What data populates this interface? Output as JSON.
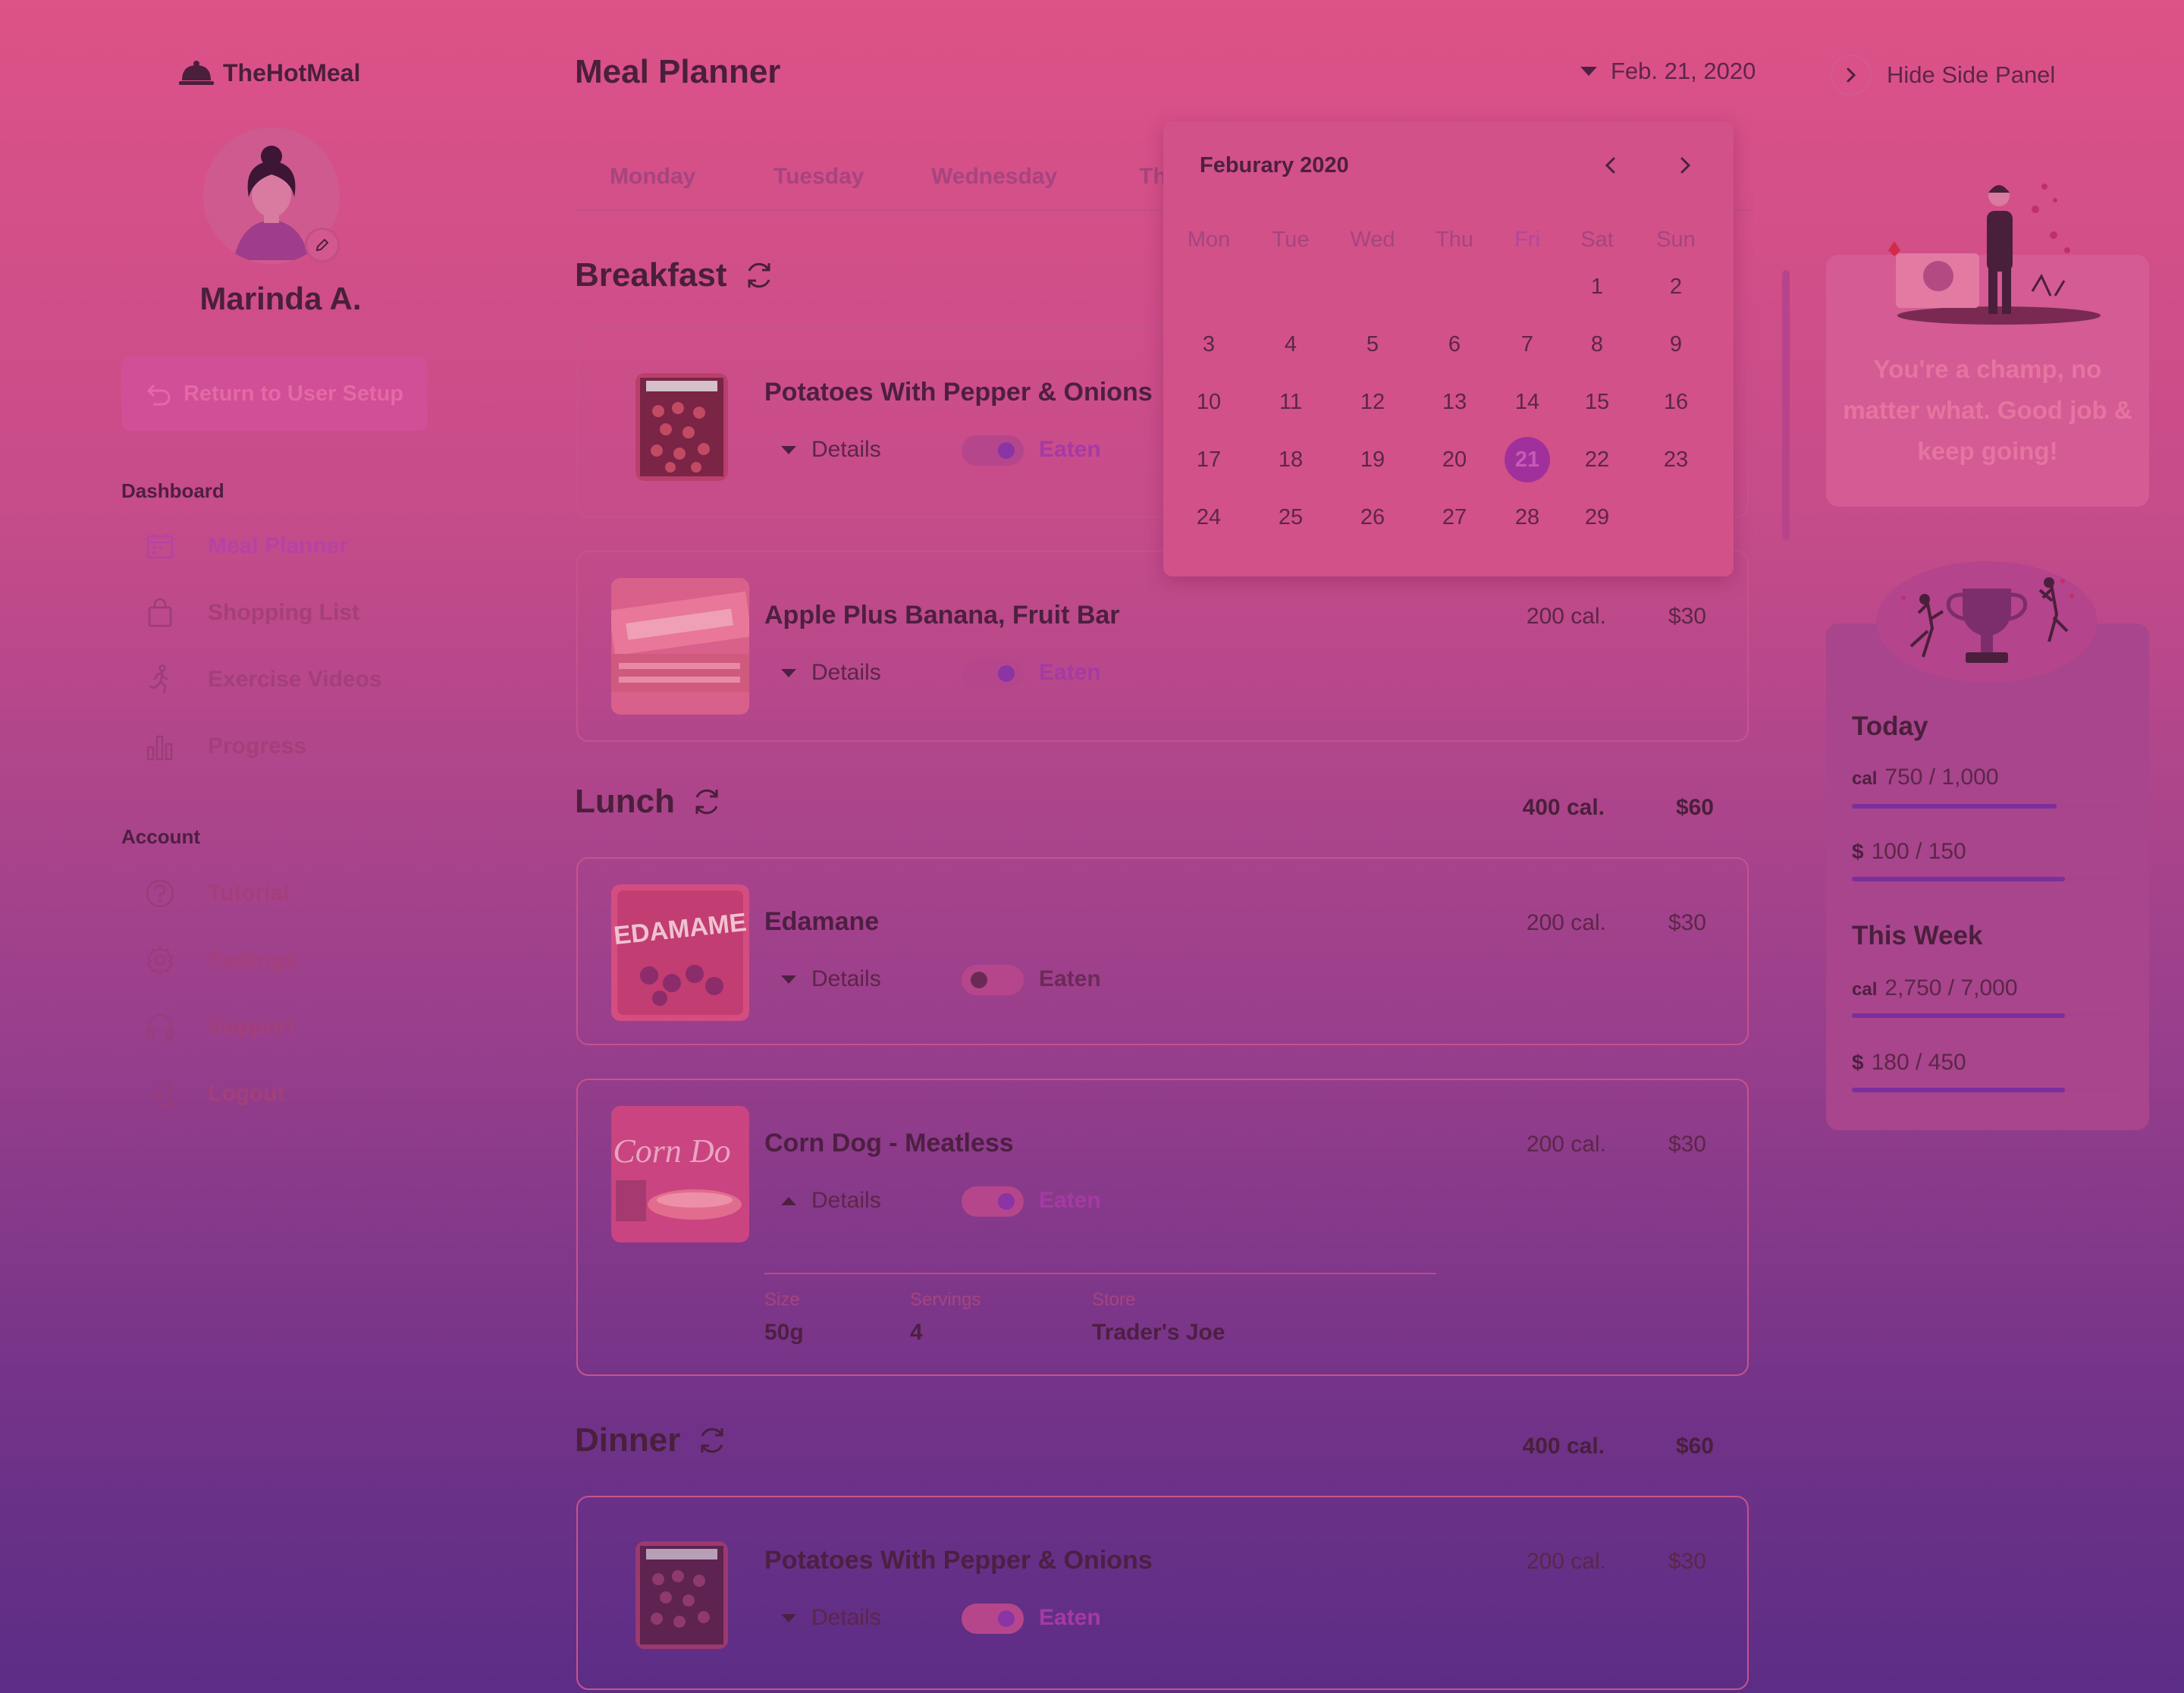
{
  "brand": {
    "name": "TheHotMeal"
  },
  "user": {
    "name": "Marinda A.",
    "return_label": "Return to User Setup"
  },
  "nav": {
    "dashboard_label": "Dashboard",
    "dashboard_items": [
      {
        "label": "Meal Planner",
        "icon": "calendar-icon",
        "active": true
      },
      {
        "label": "Shopping List",
        "icon": "shopping-bag-icon"
      },
      {
        "label": "Exercise Videos",
        "icon": "running-icon"
      },
      {
        "label": "Progress",
        "icon": "bar-chart-icon"
      }
    ],
    "account_label": "Account",
    "account_items": [
      {
        "label": "Tutorial",
        "icon": "help-icon"
      },
      {
        "label": "Settings",
        "icon": "gear-icon"
      },
      {
        "label": "Support",
        "icon": "headset-icon"
      },
      {
        "label": "Logout",
        "icon": "logout-icon"
      }
    ]
  },
  "header": {
    "title": "Meal Planner",
    "date": "Feb. 21, 2020",
    "hide_panel": "Hide Side Panel"
  },
  "tabs": [
    "Monday",
    "Tuesday",
    "Wednesday",
    "Th"
  ],
  "meals": {
    "breakfast": {
      "title": "Breakfast",
      "items": [
        {
          "name": "Potatoes With Pepper & Onions",
          "details": "Details",
          "eaten": "Eaten",
          "eaten_on": true
        },
        {
          "name": "Apple Plus Banana, Fruit Bar",
          "cal": "200 cal.",
          "price": "$30",
          "details": "Details",
          "eaten": "Eaten",
          "eaten_on": true
        }
      ]
    },
    "lunch": {
      "title": "Lunch",
      "total_cal": "400 cal.",
      "total_price": "$60",
      "items": [
        {
          "name": "Edamane",
          "cal": "200 cal.",
          "price": "$30",
          "details": "Details",
          "eaten": "Eaten",
          "eaten_on": false
        },
        {
          "name": "Corn Dog - Meatless",
          "cal": "200 cal.",
          "price": "$30",
          "details": "Details",
          "eaten": "Eaten",
          "eaten_on": true,
          "expanded": {
            "size_label": "Size",
            "size": "50g",
            "servings_label": "Servings",
            "servings": "4",
            "store_label": "Store",
            "store": "Trader's Joe"
          }
        }
      ]
    },
    "dinner": {
      "title": "Dinner",
      "total_cal": "400 cal.",
      "total_price": "$60",
      "items": [
        {
          "name": "Potatoes With Pepper & Onions",
          "cal": "200 cal.",
          "price": "$30",
          "details": "Details",
          "eaten": "Eaten",
          "eaten_on": true
        }
      ]
    }
  },
  "calendar": {
    "title": "Feburary 2020",
    "weekdays": [
      "Mon",
      "Tue",
      "Wed",
      "Thu",
      "Fri",
      "Sat",
      "Sun"
    ],
    "highlight_weekday": "Fri",
    "weeks": [
      [
        "",
        "",
        "",
        "",
        "",
        "1",
        "2"
      ],
      [
        "3",
        "4",
        "5",
        "6",
        "7",
        "8",
        "9"
      ],
      [
        "10",
        "11",
        "12",
        "13",
        "14",
        "15",
        "16"
      ],
      [
        "17",
        "18",
        "19",
        "20",
        "21",
        "22",
        "23"
      ],
      [
        "24",
        "25",
        "26",
        "27",
        "28",
        "29",
        ""
      ]
    ],
    "selected": "21"
  },
  "side_panel": {
    "champ_message": "You're a champ, no matter what. Good job & keep going!",
    "today": {
      "title": "Today",
      "cal_unit": "cal",
      "cal_value": "750 / 1,000",
      "cal_progress": 0.75,
      "money_unit": "$",
      "money_value": "100 / 150",
      "money_progress": 0.78
    },
    "week": {
      "title": "This Week",
      "cal_unit": "cal",
      "cal_value": "2,750 / 7,000",
      "cal_progress": 0.78,
      "money_unit": "$",
      "money_value": "180 / 450",
      "money_progress": 0.78
    }
  },
  "colors": {
    "accent": "#a0319c",
    "bg_top": "#dd5287",
    "bg_bottom": "#5c2d86"
  }
}
